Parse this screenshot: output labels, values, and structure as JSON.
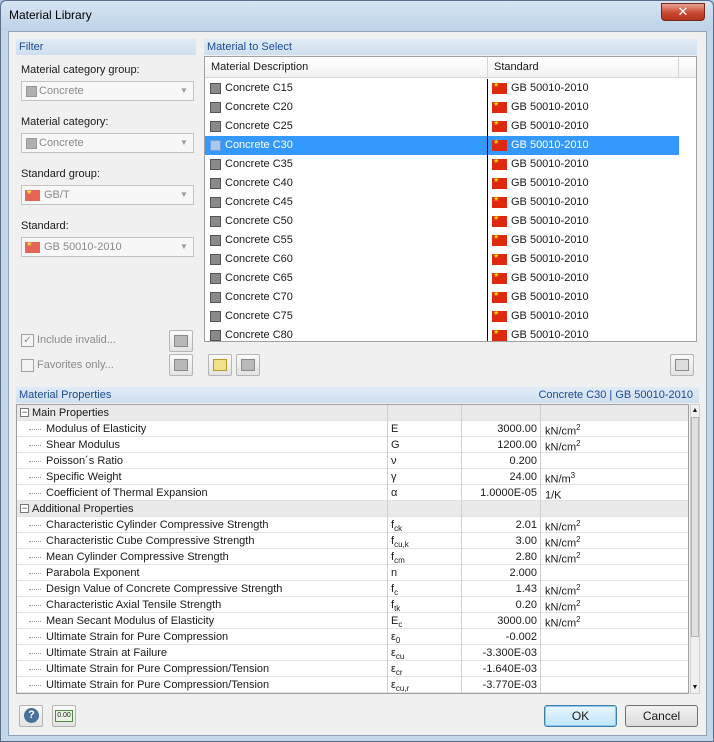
{
  "window": {
    "title": "Material Library",
    "close": "✕"
  },
  "filter": {
    "title": "Filter",
    "category_group_label": "Material category group:",
    "category_group_value": "Concrete",
    "category_label": "Material category:",
    "category_value": "Concrete",
    "standard_group_label": "Standard group:",
    "standard_group_value": "GB/T",
    "standard_label": "Standard:",
    "standard_value": "GB 50010-2010",
    "include_invalid": "Include invalid...",
    "favorites_only": "Favorites only..."
  },
  "select": {
    "title": "Material to Select",
    "col_desc": "Material Description",
    "col_std": "Standard",
    "rows": [
      {
        "desc": "Concrete C15",
        "std": "GB 50010-2010"
      },
      {
        "desc": "Concrete C20",
        "std": "GB 50010-2010"
      },
      {
        "desc": "Concrete C25",
        "std": "GB 50010-2010"
      },
      {
        "desc": "Concrete C30",
        "std": "GB 50010-2010"
      },
      {
        "desc": "Concrete C35",
        "std": "GB 50010-2010"
      },
      {
        "desc": "Concrete C40",
        "std": "GB 50010-2010"
      },
      {
        "desc": "Concrete C45",
        "std": "GB 50010-2010"
      },
      {
        "desc": "Concrete C50",
        "std": "GB 50010-2010"
      },
      {
        "desc": "Concrete C55",
        "std": "GB 50010-2010"
      },
      {
        "desc": "Concrete C60",
        "std": "GB 50010-2010"
      },
      {
        "desc": "Concrete C65",
        "std": "GB 50010-2010"
      },
      {
        "desc": "Concrete C70",
        "std": "GB 50010-2010"
      },
      {
        "desc": "Concrete C75",
        "std": "GB 50010-2010"
      },
      {
        "desc": "Concrete C80",
        "std": "GB 50010-2010"
      }
    ]
  },
  "props": {
    "title": "Material Properties",
    "selected": "Concrete C30  |  GB 50010-2010",
    "main_group": "Main Properties",
    "additional_group": "Additional Properties",
    "main": [
      {
        "name": "Modulus of Elasticity",
        "sym": "E",
        "sub": "",
        "val": "3000.00",
        "unit": "kN/cm",
        "sup": "2"
      },
      {
        "name": "Shear Modulus",
        "sym": "G",
        "sub": "",
        "val": "1200.00",
        "unit": "kN/cm",
        "sup": "2"
      },
      {
        "name": "Poisson´s Ratio",
        "sym": "ν",
        "sub": "",
        "val": "0.200",
        "unit": "",
        "sup": ""
      },
      {
        "name": "Specific Weight",
        "sym": "γ",
        "sub": "",
        "val": "24.00",
        "unit": "kN/m",
        "sup": "3"
      },
      {
        "name": "Coefficient of Thermal Expansion",
        "sym": "α",
        "sub": "",
        "val": "1.0000E-05",
        "unit": "1/K",
        "sup": ""
      }
    ],
    "additional": [
      {
        "name": "Characteristic Cylinder Compressive Strength",
        "sym": "f",
        "sub": "ck",
        "val": "2.01",
        "unit": "kN/cm",
        "sup": "2"
      },
      {
        "name": "Characteristic Cube Compressive Strength",
        "sym": "f",
        "sub": "cu,k",
        "val": "3.00",
        "unit": "kN/cm",
        "sup": "2"
      },
      {
        "name": "Mean Cylinder Compressive Strength",
        "sym": "f",
        "sub": "cm",
        "val": "2.80",
        "unit": "kN/cm",
        "sup": "2"
      },
      {
        "name": "Parabola Exponent",
        "sym": "n",
        "sub": "",
        "val": "2.000",
        "unit": "",
        "sup": ""
      },
      {
        "name": "Design Value of Concrete Compressive Strength",
        "sym": "f",
        "sub": "c",
        "val": "1.43",
        "unit": "kN/cm",
        "sup": "2"
      },
      {
        "name": "Characteristic Axial Tensile Strength",
        "sym": "f",
        "sub": "tk",
        "val": "0.20",
        "unit": "kN/cm",
        "sup": "2"
      },
      {
        "name": "Mean Secant Modulus of Elasticity",
        "sym": "E",
        "sub": "c",
        "val": "3000.00",
        "unit": "kN/cm",
        "sup": "2"
      },
      {
        "name": "Ultimate Strain for Pure Compression",
        "sym": "ε",
        "sub": "0",
        "val": "-0.002",
        "unit": "",
        "sup": ""
      },
      {
        "name": "Ultimate Strain at Failure",
        "sym": "ε",
        "sub": "cu",
        "val": "-3.300E-03",
        "unit": "",
        "sup": ""
      },
      {
        "name": "Ultimate Strain for Pure Compression/Tension",
        "sym": "ε",
        "sub": "cr",
        "val": "-1.640E-03",
        "unit": "",
        "sup": ""
      },
      {
        "name": "Ultimate Strain for Pure Compression/Tension",
        "sym": "ε",
        "sub": "cu,r",
        "val": "-3.770E-03",
        "unit": "",
        "sup": ""
      }
    ]
  },
  "footer": {
    "ok": "OK",
    "cancel": "Cancel",
    "units_icon": "0.00"
  }
}
